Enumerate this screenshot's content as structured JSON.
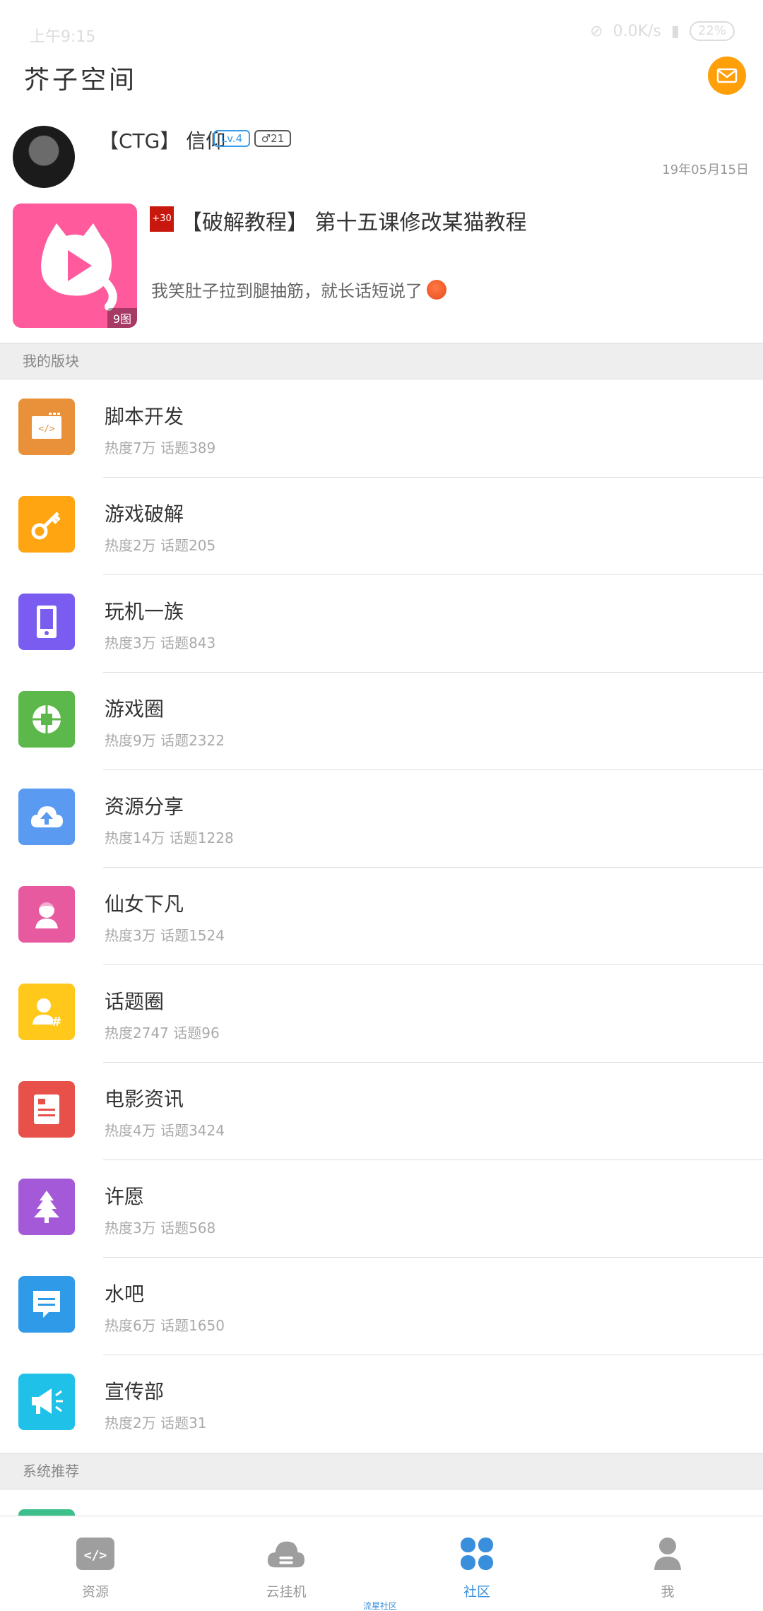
{
  "status_bar": {
    "time": "上午9:15",
    "network": "0.0K/s",
    "battery": "22%"
  },
  "header": {
    "title": "芥子空间"
  },
  "post": {
    "username": "【CTG】 信仰",
    "level": "Lv.4",
    "gender_badge": "♂21",
    "date": "19年05月15日",
    "thumb_count": "9图",
    "plus_badge": "+30",
    "title": "【破解教程】 第十五课修改某猫教程",
    "excerpt": "我笑肚子拉到腿抽筋，就长话短说了"
  },
  "sections": {
    "my_forums": "我的版块",
    "recommended": "系统推荐"
  },
  "forums": [
    {
      "name": "脚本开发",
      "stats": "热度7万  话题389",
      "color": "#e8913a",
      "icon": "code-window-icon"
    },
    {
      "name": "游戏破解",
      "stats": "热度2万  话题205",
      "color": "#ffa512",
      "icon": "key-icon"
    },
    {
      "name": "玩机一族",
      "stats": "热度3万  话题843",
      "color": "#7a5cf0",
      "icon": "phone-icon"
    },
    {
      "name": "游戏圈",
      "stats": "热度9万  话题2322",
      "color": "#5cb84a",
      "icon": "aperture-icon"
    },
    {
      "name": "资源分享",
      "stats": "热度14万  话题1228",
      "color": "#5a9af0",
      "icon": "cloud-upload-icon"
    },
    {
      "name": "仙女下凡",
      "stats": "热度3万  话题1524",
      "color": "#e85aa0",
      "icon": "girl-icon"
    },
    {
      "name": "话题圈",
      "stats": "热度2747  话题96",
      "color": "#ffc81a",
      "icon": "user-hashtag-icon"
    },
    {
      "name": "电影资讯",
      "stats": "热度4万  话题3424",
      "color": "#e8504a",
      "icon": "film-document-icon"
    },
    {
      "name": "许愿",
      "stats": "热度3万  话题568",
      "color": "#a45ad8",
      "icon": "tree-icon"
    },
    {
      "name": "水吧",
      "stats": "热度6万  话题1650",
      "color": "#2f9ae8",
      "icon": "chat-bubble-icon"
    },
    {
      "name": "宣传部",
      "stats": "热度2万  话题31",
      "color": "#1fc1e8",
      "icon": "megaphone-icon"
    }
  ],
  "tabbar": {
    "tabs": [
      {
        "label": "资源",
        "icon": "code-icon",
        "active": false
      },
      {
        "label": "云挂机",
        "icon": "cloud-icon",
        "active": false
      },
      {
        "label": "社区",
        "icon": "community-icon",
        "active": true
      },
      {
        "label": "我",
        "icon": "person-icon",
        "active": false
      }
    ],
    "home_hint": "流星社区"
  }
}
